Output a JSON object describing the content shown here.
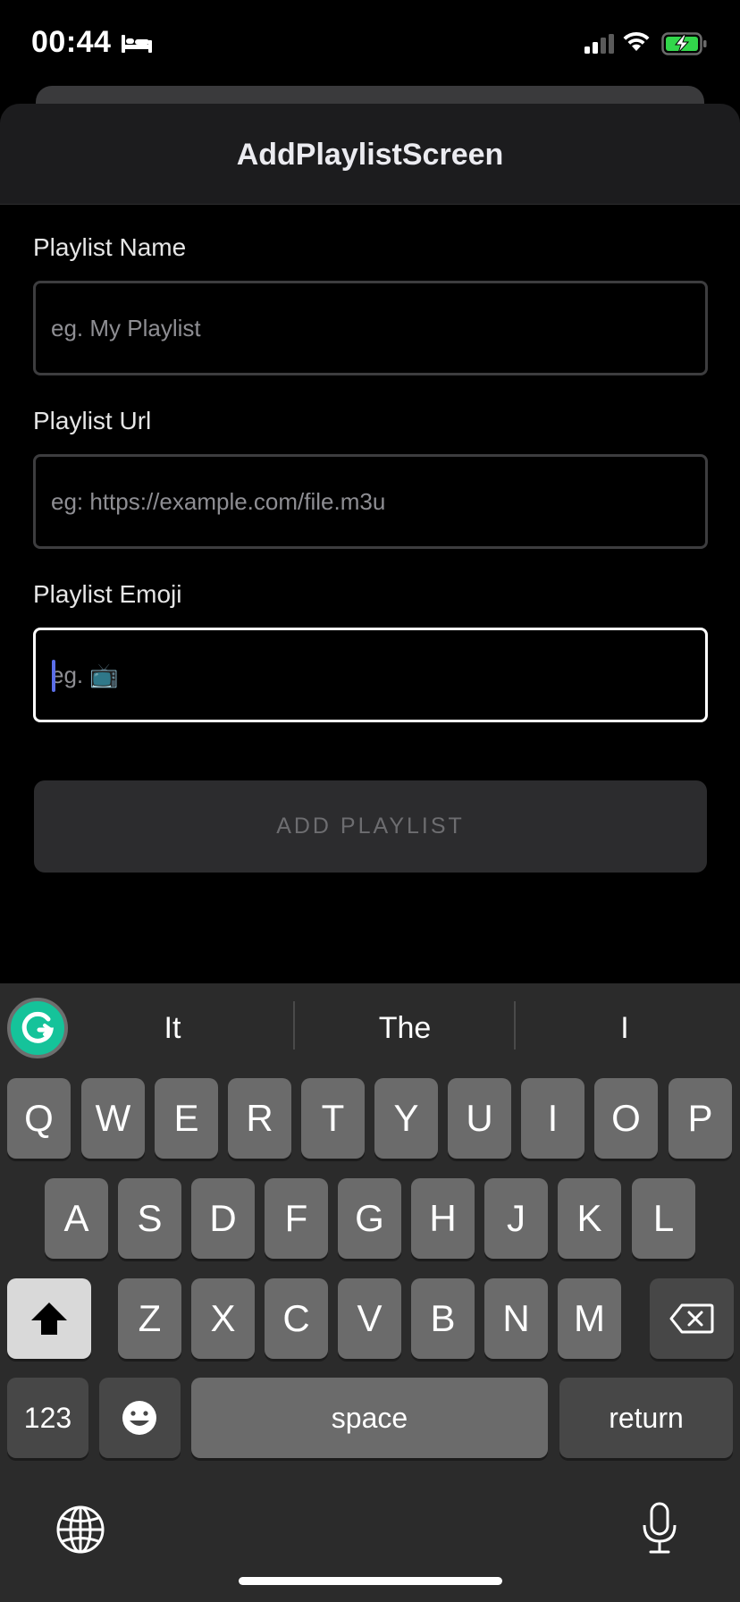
{
  "status_bar": {
    "time": "00:44"
  },
  "screen": {
    "title": "AddPlaylistScreen"
  },
  "form": {
    "name_label": "Playlist Name",
    "name_placeholder": "eg. My Playlist",
    "url_label": "Playlist Url",
    "url_placeholder": "eg: https://example.com/file.m3u",
    "emoji_label": "Playlist Emoji",
    "emoji_placeholder": "eg. 📺",
    "submit_label": "ADD PLAYLIST"
  },
  "keyboard": {
    "suggestions": [
      "It",
      "The",
      "I"
    ],
    "row1": [
      "Q",
      "W",
      "E",
      "R",
      "T",
      "Y",
      "U",
      "I",
      "O",
      "P"
    ],
    "row2": [
      "A",
      "S",
      "D",
      "F",
      "G",
      "H",
      "J",
      "K",
      "L"
    ],
    "row3": [
      "Z",
      "X",
      "C",
      "V",
      "B",
      "N",
      "M"
    ],
    "numbers_label": "123",
    "space_label": "space",
    "return_label": "return"
  },
  "colors": {
    "background": "#000000",
    "key": "#6b6b6b",
    "key_dark": "#474747",
    "focus_border": "#ffffff",
    "caret": "#5b6ee8",
    "grammarly": "#15c39a"
  },
  "icons": [
    "bed-icon",
    "signal-icon",
    "wifi-icon",
    "battery-charging-icon",
    "grammarly-icon",
    "shift-icon",
    "backspace-icon",
    "emoji-icon",
    "globe-icon",
    "microphone-icon"
  ]
}
